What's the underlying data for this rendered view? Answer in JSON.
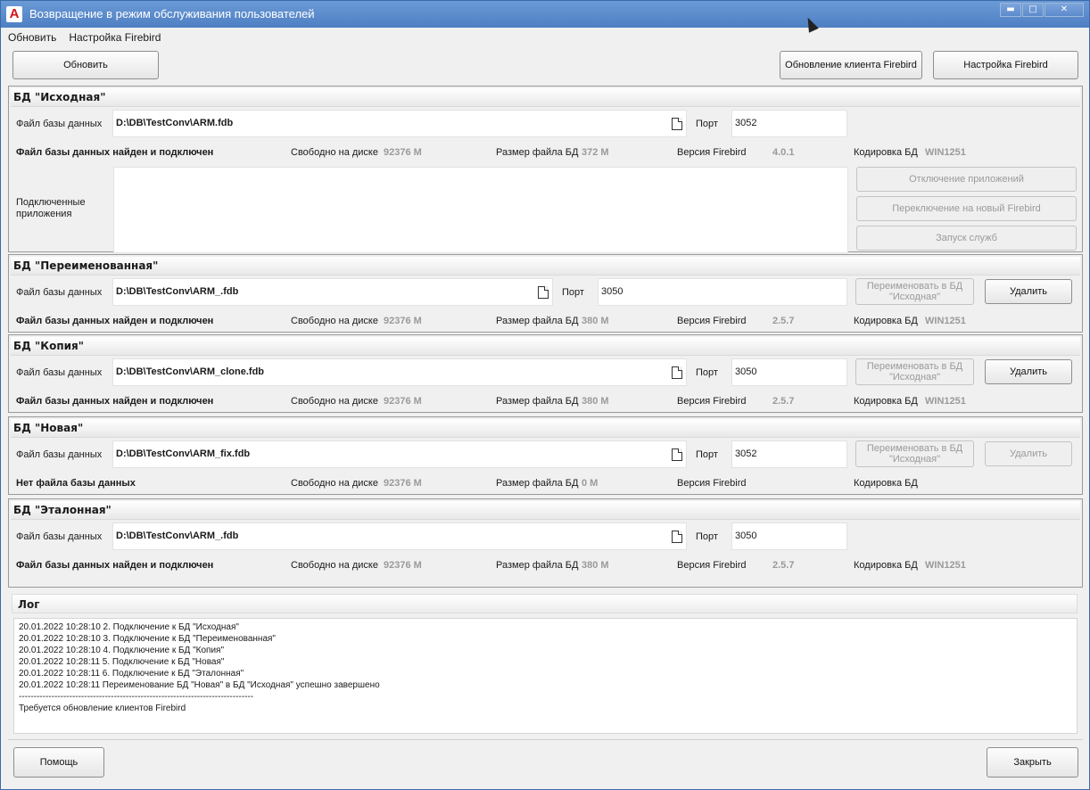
{
  "window": {
    "title": "Возвращение в режим обслуживания пользователей",
    "app_icon_letter": "A",
    "min_icon": "minimize-icon",
    "max_icon": "maximize-icon",
    "close_icon": "close-icon",
    "min_glyph": "▬",
    "max_glyph": "□",
    "close_glyph": "✕"
  },
  "menu": {
    "refresh": "Обновить",
    "fb_settings": "Настройка Firebird"
  },
  "toolbar": {
    "refresh": "Обновить",
    "update_client": "Обновление клиента Firebird",
    "fb_settings": "Настройка Firebird"
  },
  "labels": {
    "file": "Файл базы данных",
    "port": "Порт",
    "free": "Свободно на диске",
    "size": "Размер файла  БД",
    "version": "Версия Firebird",
    "encoding": "Кодировка БД",
    "connected_apps": "Подключенные приложения",
    "rename": "Переименовать в БД \"Исходная\"",
    "delete": "Удалить"
  },
  "panels": [
    {
      "title": "БД \"Исходная\"",
      "file": "D:\\DB\\TestConv\\ARM.fdb",
      "port": "3052",
      "status": "Файл базы данных найден и подключен",
      "free": "92376 M",
      "size": "372 M",
      "version": "4.0.1",
      "encoding": "WIN1251"
    },
    {
      "title": "БД \"Переименованная\"",
      "file": "D:\\DB\\TestConv\\ARM_.fdb",
      "port": "3050",
      "status": "Файл базы данных найден и подключен",
      "free": "92376 M",
      "size": "380 M",
      "version": "2.5.7",
      "encoding": "WIN1251"
    },
    {
      "title": "БД \"Копия\"",
      "file": "D:\\DB\\TestConv\\ARM_clone.fdb",
      "port": "3050",
      "status": "Файл базы данных найден и подключен",
      "free": "92376 M",
      "size": "380 M",
      "version": "2.5.7",
      "encoding": "WIN1251"
    },
    {
      "title": "БД \"Новая\"",
      "file": "D:\\DB\\TestConv\\ARM_fix.fdb",
      "port": "3052",
      "status": "Нет файла базы данных",
      "free": "92376 M",
      "size": "0 M",
      "version": "",
      "encoding": ""
    },
    {
      "title": "БД \"Эталонная\"",
      "file": "D:\\DB\\TestConv\\ARM_.fdb",
      "port": "3050",
      "status": "Файл базы данных найден и подключен",
      "free": "92376 M",
      "size": "380 M",
      "version": "2.5.7",
      "encoding": "WIN1251"
    }
  ],
  "side_buttons": {
    "disconnect": "Отключение приложений",
    "switch": "Переключение на новый Firebird",
    "start": "Запуск служб"
  },
  "log": {
    "title": "Лог",
    "lines": [
      "20.01.2022 10:28:10 2. Подключение к БД \"Исходная\"",
      "20.01.2022 10:28:10 3. Подключение к БД \"Переименованная\"",
      "20.01.2022 10:28:10 4. Подключение к БД \"Копия\"",
      "20.01.2022 10:28:11 5. Подключение к БД \"Новая\"",
      "20.01.2022 10:28:11 6. Подключение к БД \"Эталонная\"",
      "20.01.2022 10:28:11 Переименование БД \"Новая\" в БД \"Исходная\" успешно завершено",
      "-------------------------------------------------------------------------------",
      "Требуется обновление клиентов Firebird"
    ]
  },
  "footer": {
    "help": "Помощь",
    "close": "Закрыть"
  }
}
